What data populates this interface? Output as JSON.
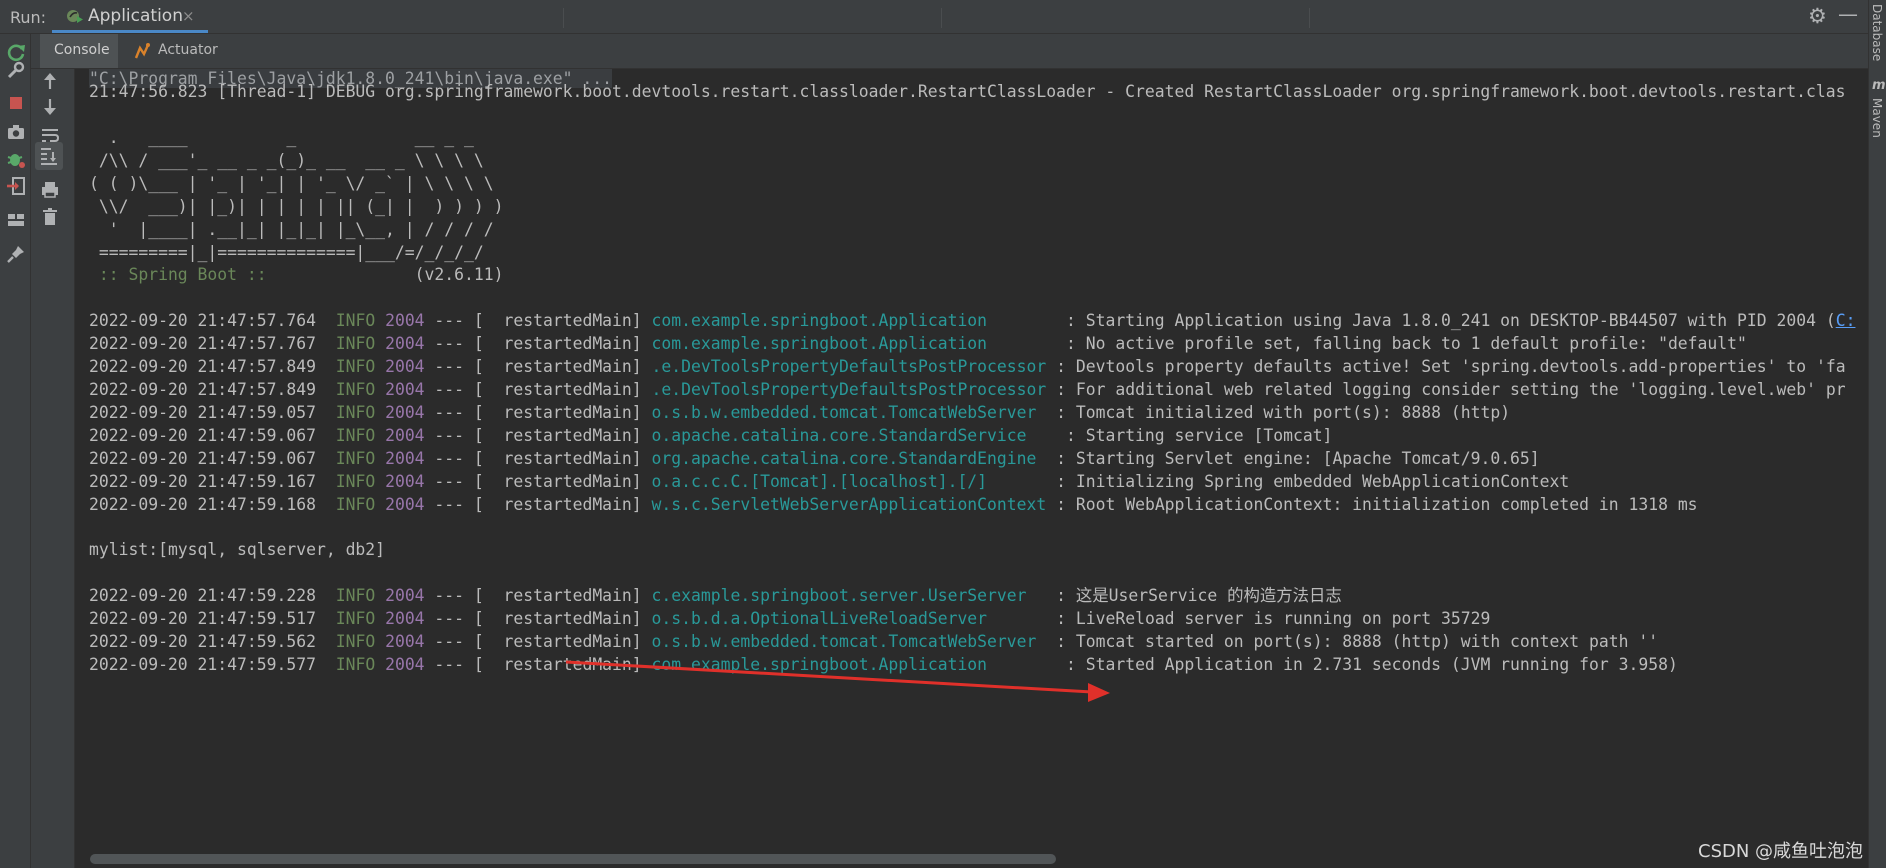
{
  "topbar": {
    "run_label": "Run:",
    "tab_label": "Application",
    "tab_close": "×",
    "gear_icon": "gear-icon",
    "minimize_icon": "minimize-icon"
  },
  "right_strip": {
    "database_label": "Database",
    "maven_label": "Maven"
  },
  "subtabs": {
    "console": "Console",
    "actuator": "Actuator"
  },
  "console": {
    "cmd": "\"C:\\Program Files\\Java\\jdk1.8.0_241\\bin\\java.exe\" ...",
    "debug_line": "21:47:56.823 [Thread-1] DEBUG org.springframework.boot.devtools.restart.classloader.RestartClassLoader - Created RestartClassLoader org.springframework.boot.devtools.restart.clas",
    "banner": [
      "  .   ____          _            __ _ _",
      " /\\\\ / ___'_ __ _ _(_)_ __  __ _ \\ \\ \\ \\",
      "( ( )\\___ | '_ | '_| | '_ \\/ _` | \\ \\ \\ \\",
      " \\\\/  ___)| |_)| | | | | || (_| |  ) ) ) )",
      "  '  |____| .__|_| |_|_| |_\\__, | / / / /",
      " =========|_|==============|___/=/_/_/_/"
    ],
    "spring_label": " :: Spring Boot :: ",
    "spring_version": "              (v2.6.11)",
    "mylist": "mylist:[mysql, sqlserver, db2]",
    "log_block1": [
      {
        "ts": "2022-09-20 21:47:57.764",
        "level": "INFO",
        "pid": "2004",
        "thread": " --- [  restartedMain] ",
        "logger": "com.example.springboot.Application       ",
        "msg": " : Starting Application using Java 1.8.0_241 on DESKTOP-BB44507 with PID 2004 (",
        "link": "C:"
      },
      {
        "ts": "2022-09-20 21:47:57.767",
        "level": "INFO",
        "pid": "2004",
        "thread": " --- [  restartedMain] ",
        "logger": "com.example.springboot.Application       ",
        "msg": " : No active profile set, falling back to 1 default profile: \"default\""
      },
      {
        "ts": "2022-09-20 21:47:57.849",
        "level": "INFO",
        "pid": "2004",
        "thread": " --- [  restartedMain] ",
        "logger": ".e.DevToolsPropertyDefaultsPostProcessor",
        "msg": " : Devtools property defaults active! Set 'spring.devtools.add-properties' to 'fa"
      },
      {
        "ts": "2022-09-20 21:47:57.849",
        "level": "INFO",
        "pid": "2004",
        "thread": " --- [  restartedMain] ",
        "logger": ".e.DevToolsPropertyDefaultsPostProcessor",
        "msg": " : For additional web related logging consider setting the 'logging.level.web' pr"
      },
      {
        "ts": "2022-09-20 21:47:59.057",
        "level": "INFO",
        "pid": "2004",
        "thread": " --- [  restartedMain] ",
        "logger": "o.s.b.w.embedded.tomcat.TomcatWebServer ",
        "msg": " : Tomcat initialized with port(s): 8888 (http)"
      },
      {
        "ts": "2022-09-20 21:47:59.067",
        "level": "INFO",
        "pid": "2004",
        "thread": " --- [  restartedMain] ",
        "logger": "o.apache.catalina.core.StandardService   ",
        "msg": " : Starting service [Tomcat]"
      },
      {
        "ts": "2022-09-20 21:47:59.067",
        "level": "INFO",
        "pid": "2004",
        "thread": " --- [  restartedMain] ",
        "logger": "org.apache.catalina.core.StandardEngine ",
        "msg": " : Starting Servlet engine: [Apache Tomcat/9.0.65]"
      },
      {
        "ts": "2022-09-20 21:47:59.167",
        "level": "INFO",
        "pid": "2004",
        "thread": " --- [  restartedMain] ",
        "logger": "o.a.c.c.C.[Tomcat].[localhost].[/]      ",
        "msg": " : Initializing Spring embedded WebApplicationContext"
      },
      {
        "ts": "2022-09-20 21:47:59.168",
        "level": "INFO",
        "pid": "2004",
        "thread": " --- [  restartedMain] ",
        "logger": "w.s.c.ServletWebServerApplicationContext",
        "msg": " : Root WebApplicationContext: initialization completed in 1318 ms"
      }
    ],
    "log_block2": [
      {
        "ts": "2022-09-20 21:47:59.228",
        "level": "INFO",
        "pid": "2004",
        "thread": " --- [  restartedMain] ",
        "logger": "c.example.springboot.server.UserServer  ",
        "msg": " : 这是UserService 的构造方法日志"
      },
      {
        "ts": "2022-09-20 21:47:59.517",
        "level": "INFO",
        "pid": "2004",
        "thread": " --- [  restartedMain] ",
        "logger": "o.s.b.d.a.OptionalLiveReloadServer      ",
        "msg": " : LiveReload server is running on port 35729"
      },
      {
        "ts": "2022-09-20 21:47:59.562",
        "level": "INFO",
        "pid": "2004",
        "thread": " --- [  restartedMain] ",
        "logger": "o.s.b.w.embedded.tomcat.TomcatWebServer ",
        "msg": " : Tomcat started on port(s): 8888 (http) with context path ''"
      },
      {
        "ts": "2022-09-20 21:47:59.577",
        "level": "INFO",
        "pid": "2004",
        "thread": " --- [  restartedMain] ",
        "logger": "com.example.springboot.Application       ",
        "msg": " : Started Application in 2.731 seconds (JVM running for 3.958)"
      }
    ]
  },
  "watermark": "CSDN @咸鱼吐泡泡",
  "colors": {
    "background": "#2b2b2b",
    "panel": "#3c3f41",
    "info": "#6a8759",
    "pid": "#9876aa",
    "logger": "#299999",
    "arrow": "#e0302a",
    "tab_underline": "#4a88c7"
  }
}
